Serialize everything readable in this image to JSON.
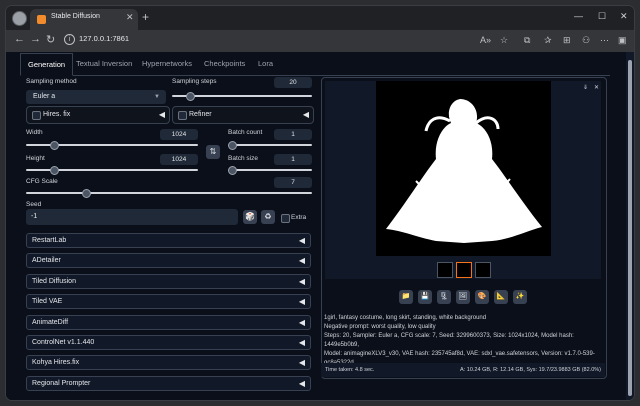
{
  "browser": {
    "tab_title": "Stable Diffusion",
    "tab_close": "✕",
    "new_tab": "+",
    "url": "127.0.0.1:7861",
    "controls": {
      "minimize": "—",
      "maximize": "☐",
      "close": "✕"
    },
    "nav": {
      "back": "←",
      "forward": "→",
      "reload": "↻"
    },
    "address_icons": [
      "A»",
      "☆",
      "⧉",
      "✰",
      "⊞",
      "⚇",
      "⋯",
      "▣"
    ]
  },
  "tabs": [
    "Generation",
    "Textual Inversion",
    "Hypernetworks",
    "Checkpoints",
    "Lora"
  ],
  "generation": {
    "sampling_method_label": "Sampling method",
    "sampling_method_value": "Euler a",
    "sampling_steps_label": "Sampling steps",
    "sampling_steps_value": "20",
    "sampling_steps_fraction": 0.13,
    "hires_fix": "Hires. fix",
    "refiner": "Refiner",
    "width_label": "Width",
    "width_value": "1024",
    "width_fraction": 0.16,
    "height_label": "Height",
    "height_value": "1024",
    "height_fraction": 0.16,
    "swap_icon": "⇅",
    "batch_count_label": "Batch count",
    "batch_count_value": "1",
    "batch_count_fraction": 0.0,
    "batch_size_label": "Batch size",
    "batch_size_value": "1",
    "batch_size_fraction": 0.0,
    "cfg_label": "CFG Scale",
    "cfg_value": "7",
    "cfg_fraction": 0.21,
    "seed_label": "Seed",
    "seed_value": "-1",
    "dice_icon": "🎲",
    "recycle_icon": "♻",
    "extra_label": "Extra"
  },
  "accordions": [
    "RestartLab",
    "ADetailer",
    "Tiled Diffusion",
    "Tiled VAE",
    "AnimateDiff",
    "ControlNet v1.1.440",
    "Kohya Hires.fix",
    "Regional Prompter"
  ],
  "output": {
    "panel_icons": [
      "⇓",
      "✕"
    ],
    "tool_icons": [
      "📁",
      "💾",
      "🗜",
      "🖼",
      "🎨",
      "📐",
      "✨"
    ],
    "line1": "1girl, fantasy costume, long skirt, standing, white background",
    "line2": "Negative prompt: worst quality, low quality",
    "line3": "Steps: 20, Sampler: Euler a, CFG scale: 7, Seed: 3299600373, Size: 1024x1024, Model hash: 1449e5b0b9,",
    "line4": "Model: animagineXLV3_v30, VAE hash: 235745af8d, VAE: sdxl_vae.safetensors, Version: v1.7.0-539-",
    "line5": "gc8a5322d",
    "time_taken": "Time taken: 4.8 sec.",
    "memory": "A: 10.24 GB, R: 12.14 GB, Sys: 19.7/23.9883 GB (82.0%)"
  },
  "colors": {
    "background": "#0b0f19",
    "accent": "#f97316",
    "panel": "#1f2937"
  }
}
